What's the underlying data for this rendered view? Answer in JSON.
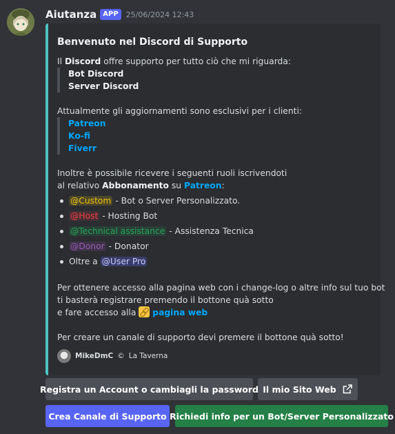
{
  "message": {
    "author": "Aiutanza",
    "badge": "APP",
    "timestamp": "25/06/2024 12:43"
  },
  "embed": {
    "accent_color": "#4fc3c0",
    "title": "Benvenuto nel Discord di Supporto",
    "intro": {
      "prefix": "Il ",
      "bold": "Discord",
      "suffix": " offre supporto per tutto ciò che mi riguarda:"
    },
    "support_items": [
      "Bot Discord",
      "Server Discord"
    ],
    "updates_text": "Attualmente gli aggiornamenti sono esclusivi per i clienti:",
    "platforms": [
      "Patreon",
      "Ko-fi",
      "Fiverr"
    ],
    "roles_intro": {
      "line1": "Inoltre è possibile ricevere i seguenti ruoli iscrivendoti",
      "line2_prefix": "al relativo ",
      "line2_bold": "Abbonamento",
      "line2_mid": " su ",
      "line2_link": "Patreon",
      "line2_suffix": ":"
    },
    "roles": [
      {
        "mention": "@Custom",
        "desc": " - Bot o Server Personalizzato.",
        "color": "#f1c40f"
      },
      {
        "mention": "@Host",
        "desc": " - Hosting Bot",
        "color": "#f23f43"
      },
      {
        "mention": "@Technical assistance",
        "desc": " - Assistenza Tecnica",
        "color": "#23a55a"
      },
      {
        "mention": "@Donor",
        "desc": " - Donator",
        "color": "#9b59b6"
      }
    ],
    "last_role": {
      "prefix": "Oltre a ",
      "mention": "@User Pro"
    },
    "web_text": {
      "line1": "Per ottenere accesso alla pagina web con i change-log o altre info sul tuo bot",
      "line2": "ti basterà registrare premendo il bottone quà sotto",
      "line3_prefix": "e fare accesso alla ",
      "link_icon": "link-emoji",
      "line3_link": "pagina web"
    },
    "support_channel_text": "Per creare un canale di supporto devi premere il bottone quà sotto!",
    "footer": {
      "name": "MikeDmC",
      "separator": "©",
      "server": "La Taverna"
    }
  },
  "buttons": {
    "register": "Registra un Account o cambiagli la password",
    "website": "Il mio Sito Web",
    "website_icon": "external-link-icon",
    "support": "Crea Canale di Supporto",
    "request": "Richiedi info per un Bot/Server Personalizzato"
  }
}
